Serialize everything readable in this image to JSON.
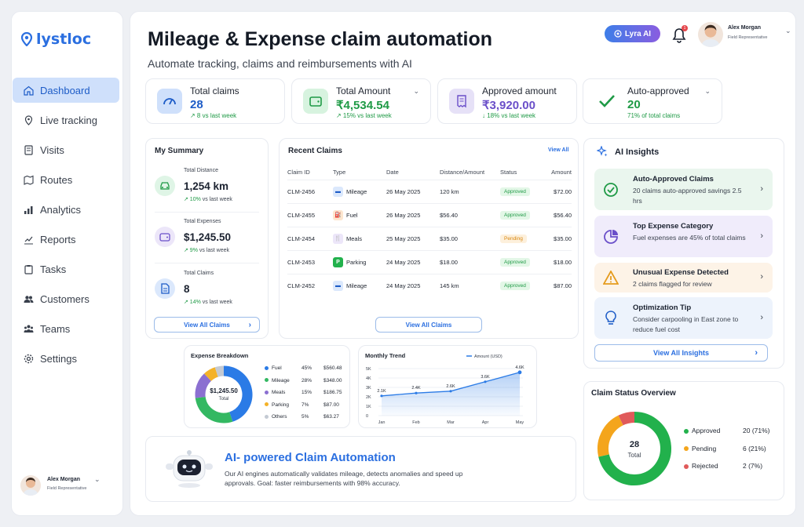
{
  "brand": {
    "name": "lystloc",
    "color": "#2b6fe0"
  },
  "nav": [
    {
      "label": "Dashboard",
      "icon": "home-icon",
      "active": true
    },
    {
      "label": "Live tracking",
      "icon": "location-pin-icon"
    },
    {
      "label": "Visits",
      "icon": "document-icon"
    },
    {
      "label": "Routes",
      "icon": "map-icon"
    },
    {
      "label": "Analytics",
      "icon": "bar-chart-icon"
    },
    {
      "label": "Reports",
      "icon": "report-chart-icon"
    },
    {
      "label": "Tasks",
      "icon": "clipboard-icon"
    },
    {
      "label": "Customers",
      "icon": "users-icon"
    },
    {
      "label": "Teams",
      "icon": "team-icon"
    },
    {
      "label": "Settings",
      "icon": "gear-icon"
    }
  ],
  "user": {
    "name": "Alex Morgan",
    "role": "Field Representative"
  },
  "header": {
    "title": "Mileage & Expense claim automation",
    "subtitle": "Automate tracking, claims and reimbursements with AI",
    "ai_button": "Lyra AI",
    "notification_count": "1"
  },
  "kpis": [
    {
      "label": "Total claims",
      "value": "28",
      "sub": "↗ 8 vs last week",
      "value_color": "#1d5cc7",
      "sub_color": "#1f9a46"
    },
    {
      "label": "Total Amount",
      "value": "₹4,534.54",
      "sub": "↗ 15% vs last week",
      "value_color": "#1f9a46",
      "sub_color": "#1f9a46"
    },
    {
      "label": "Approved amount",
      "value": "₹3,920.00",
      "sub": "↓ 18% vs last week",
      "value_color": "#6a4fc9",
      "sub_color": "#1f9a46"
    },
    {
      "label": "Auto-approved",
      "value": "20",
      "sub": "71% of total claims",
      "value_color": "#1f9a46",
      "sub_color": "#1f9a46"
    }
  ],
  "summary": {
    "title": "My Summary",
    "rows": [
      {
        "label": "Total Distance",
        "value": "1,254 km",
        "change": "↗ 10%",
        "suffix": "vs last week"
      },
      {
        "label": "Total Expenses",
        "value": "$1,245.50",
        "change": "↗ 9%",
        "suffix": "vs last week"
      },
      {
        "label": "Total Claims",
        "value": "8",
        "change": "↗ 14%",
        "suffix": "vs last week"
      }
    ],
    "button": "View All Claims"
  },
  "recent": {
    "title": "Recent Claims",
    "view_all": "View All",
    "headers": [
      "Claim ID",
      "Type",
      "Date",
      "Distance/Amount",
      "Status",
      "Amount"
    ],
    "rows": [
      {
        "id": "CLM-2456",
        "type": "Mileage",
        "date": "26 May 2025",
        "dist": "120 km",
        "status": "Approved",
        "amount": "$72.00"
      },
      {
        "id": "CLM-2455",
        "type": "Fuel",
        "date": "26 May 2025",
        "dist": "$56.40",
        "status": "Approved",
        "amount": "$56.40"
      },
      {
        "id": "CLM-2454",
        "type": "Meals",
        "date": "25 May 2025",
        "dist": "$35.00",
        "status": "Pending",
        "amount": "$35.00"
      },
      {
        "id": "CLM-2453",
        "type": "Parking",
        "date": "24 May 2025",
        "dist": "$18.00",
        "status": "Approved",
        "amount": "$18.00"
      },
      {
        "id": "CLM-2452",
        "type": "Mileage",
        "date": "24 May 2025",
        "dist": "145 km",
        "status": "Approved",
        "amount": "$87.00"
      }
    ],
    "button": "View All Claims"
  },
  "insights": {
    "title": "AI Insights",
    "items": [
      {
        "title": "Auto-Approved Claims",
        "desc": "20 claims auto-approved savings 2.5 hrs"
      },
      {
        "title": "Top Expense Category",
        "desc": "Fuel expenses are 45% of total claims"
      },
      {
        "title": "Unusual Expense Detected",
        "desc": "2 claims flagged for review"
      },
      {
        "title": "Optimization Tip",
        "desc": "Consider carpooling in East zone to reduce fuel cost"
      }
    ],
    "button": "View All Insights"
  },
  "breakdown": {
    "title": "Expense Breakdown",
    "center_value": "$1,245.50",
    "center_label": "Total"
  },
  "trend": {
    "title": "Monthly Trend"
  },
  "status": {
    "title": "Claim Status Overview",
    "center_value": "28",
    "center_label": "Total"
  },
  "automation": {
    "title": "AI- powered Claim Automation",
    "desc": "Our AI engines automatically validates mileage, detects anomalies and speed up approvals. Goal: faster reimbursements with 98% accuracy."
  },
  "chart_data": [
    {
      "type": "pie",
      "title": "Expense Breakdown",
      "categories": [
        "Fuel",
        "Mileage",
        "Meals",
        "Parking",
        "Others"
      ],
      "percent_labels": [
        "45%",
        "28%",
        "15%",
        "7%",
        "5%"
      ],
      "amount_labels": [
        "$560.48",
        "$348.00",
        "$186.75",
        "$87.00",
        "$63.27"
      ],
      "values": [
        45,
        28,
        15,
        7,
        5
      ],
      "colors": [
        "#2b7be6",
        "#33b862",
        "#8b6fd1",
        "#f4b228",
        "#c4cad3"
      ]
    },
    {
      "type": "area",
      "title": "Monthly Trend",
      "categories": [
        "Jan",
        "Feb",
        "Mar",
        "Apr",
        "May"
      ],
      "series": [
        {
          "name": "Amount (USD)",
          "values": [
            2.1,
            2.4,
            2.6,
            3.6,
            4.6
          ]
        }
      ],
      "value_labels": [
        "2.1K",
        "2.4K",
        "2.6K",
        "3.6K",
        "4.6K"
      ],
      "ytick_labels": [
        "0",
        "1K",
        "2K",
        "3K",
        "4K",
        "5K"
      ],
      "ylim": [
        0,
        5
      ]
    },
    {
      "type": "pie",
      "title": "Claim Status Overview",
      "categories": [
        "Approved",
        "Pending",
        "Rejected"
      ],
      "count_labels": [
        "20 (71%)",
        "6 (21%)",
        "2 (7%)"
      ],
      "values": [
        20,
        6,
        2
      ],
      "colors": [
        "#22b14c",
        "#f4a51c",
        "#e05a5a"
      ]
    }
  ]
}
